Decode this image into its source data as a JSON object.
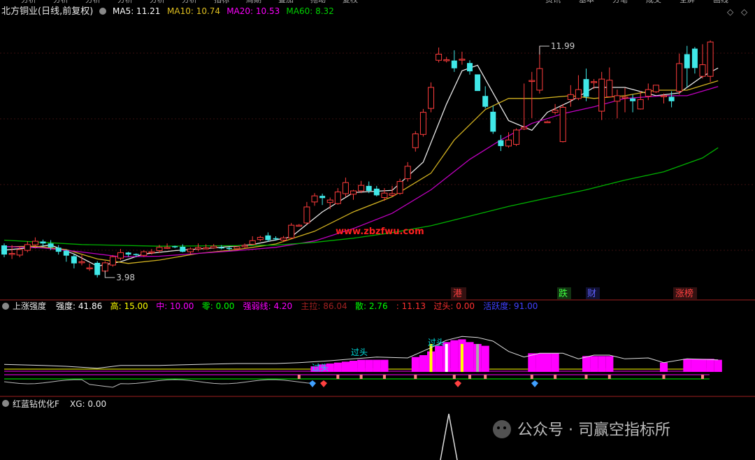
{
  "top_menu": [
    "分析",
    "分析",
    "分析",
    "分析",
    "分析",
    "分析",
    "指标",
    "周期",
    "叠加",
    "拖动",
    "复权"
  ],
  "top_right_menu": [
    "资讯",
    "基本",
    "分笔",
    "成交",
    "全屏",
    "画线"
  ],
  "main_panel": {
    "title": "北方铜业(日线,前复权)",
    "ma_labels": [
      {
        "text": "MA5: 11.21",
        "color": "#ffffff"
      },
      {
        "text": "MA10: 10.74",
        "color": "#e0c020"
      },
      {
        "text": "MA20: 10.53",
        "color": "#ff00ff"
      },
      {
        "text": "MA60: 8.32",
        "color": "#00d000"
      }
    ],
    "high_label": "11.99",
    "low_label": "3.98",
    "watermark": "www.zbzfwu.com",
    "event_tags": [
      {
        "text": "港",
        "color": "#ff4040"
      },
      {
        "text": "跌",
        "color": "#40ff40"
      },
      {
        "text": "财",
        "color": "#6060ff"
      },
      {
        "text": "涨榜",
        "color": "#ff4040"
      }
    ]
  },
  "indicator_panel": {
    "name": "上涨强度",
    "values": [
      {
        "text": "强度: 41.86",
        "color": "#ffffff"
      },
      {
        "text": "高: 15.00",
        "color": "#ffff00"
      },
      {
        "text": "中: 10.00",
        "color": "#ff00ff"
      },
      {
        "text": "零: 0.00",
        "color": "#00ff00"
      },
      {
        "text": "强弱线: 4.20",
        "color": "#ff00ff"
      },
      {
        "text": "主拉: 86.04",
        "color": "#a02020"
      },
      {
        "text": "散: 2.76",
        "color": "#00ff00"
      },
      {
        "text": ": 11.13",
        "color": "#ff3030"
      },
      {
        "text": "过头: 0.00",
        "color": "#ff3030"
      },
      {
        "text": "活跃度: 91.00",
        "color": "#4040ff"
      }
    ],
    "guotou_label": "过头"
  },
  "bottom_panel": {
    "name": "红蓝钻优化F",
    "value": "XG: 0.00"
  },
  "wechat": {
    "text": "公众号 · 司赢空指标所"
  },
  "chart_data": {
    "type": "candlestick",
    "title": "北方铜业(日线,前复权)",
    "ylim": [
      3.3,
      12.9
    ],
    "candles": [
      [
        4.79,
        4.46,
        4.86,
        4.36
      ],
      [
        4.5,
        4.5,
        4.8,
        4.3
      ],
      [
        4.44,
        4.64,
        4.76,
        4.36
      ],
      [
        4.61,
        4.82,
        4.94,
        4.54
      ],
      [
        4.81,
        4.94,
        5.08,
        4.68
      ],
      [
        4.93,
        4.86,
        5.0,
        4.74
      ],
      [
        4.86,
        4.72,
        4.98,
        4.62
      ],
      [
        4.71,
        4.56,
        4.8,
        4.46
      ],
      [
        4.6,
        4.42,
        4.64,
        4.2
      ],
      [
        4.4,
        4.14,
        4.46,
        3.96
      ],
      [
        4.2,
        4.2,
        4.44,
        4.07
      ],
      [
        3.98,
        3.98,
        4.14,
        3.87
      ],
      [
        4.16,
        3.72,
        4.22,
        3.63
      ],
      [
        3.86,
        4.16,
        4.22,
        3.8
      ],
      [
        4.08,
        4.38,
        4.44,
        4.02
      ],
      [
        4.33,
        4.53,
        4.66,
        4.26
      ],
      [
        4.53,
        4.46,
        4.56,
        4.38
      ],
      [
        4.48,
        4.46,
        4.5,
        4.36
      ],
      [
        4.43,
        4.56,
        4.61,
        4.37
      ],
      [
        4.56,
        4.56,
        4.66,
        4.46
      ],
      [
        4.6,
        4.72,
        4.81,
        4.52
      ],
      [
        4.72,
        4.72,
        4.86,
        4.66
      ],
      [
        4.76,
        4.75,
        4.78,
        4.69
      ],
      [
        4.74,
        4.56,
        4.83,
        4.54
      ],
      [
        4.56,
        4.66,
        4.72,
        4.48
      ],
      [
        4.66,
        4.71,
        4.86,
        4.58
      ],
      [
        4.7,
        4.7,
        4.83,
        4.66
      ],
      [
        4.7,
        4.76,
        4.84,
        4.67
      ],
      [
        4.72,
        4.71,
        4.8,
        4.65
      ],
      [
        4.7,
        4.66,
        4.74,
        4.6
      ],
      [
        4.67,
        4.74,
        4.76,
        4.61
      ],
      [
        4.74,
        4.79,
        4.86,
        4.7
      ],
      [
        4.83,
        4.96,
        5.12,
        4.8
      ],
      [
        5.0,
        5.08,
        5.14,
        4.94
      ],
      [
        5.15,
        4.98,
        5.26,
        4.92
      ],
      [
        5.05,
        5.02,
        5.12,
        4.96
      ],
      [
        4.98,
        5.06,
        5.13,
        4.91
      ],
      [
        5.06,
        5.52,
        5.6,
        5.03
      ],
      [
        5.52,
        5.52,
        5.56,
        5.48
      ],
      [
        5.6,
        6.18,
        6.36,
        5.55
      ],
      [
        6.36,
        6.58,
        6.68,
        6.22
      ],
      [
        6.58,
        6.5,
        6.66,
        6.25
      ],
      [
        6.34,
        6.43,
        6.52,
        6.1
      ],
      [
        6.3,
        6.72,
        6.86,
        6.26
      ],
      [
        6.66,
        7.06,
        7.24,
        6.54
      ],
      [
        6.64,
        6.76,
        6.8,
        6.44
      ],
      [
        6.76,
        6.96,
        7.12,
        6.68
      ],
      [
        6.94,
        6.76,
        7.1,
        6.68
      ],
      [
        6.84,
        6.6,
        6.94,
        6.56
      ],
      [
        6.52,
        6.68,
        6.86,
        6.4
      ],
      [
        6.6,
        6.66,
        6.94,
        6.56
      ],
      [
        6.67,
        7.1,
        7.2,
        6.62
      ],
      [
        7.2,
        7.65,
        7.8,
        7.1
      ],
      [
        8.32,
        8.82,
        8.92,
        8.18
      ],
      [
        8.8,
        9.6,
        9.72,
        8.72
      ],
      [
        9.74,
        10.5,
        10.68,
        9.6
      ],
      [
        11.48,
        11.7,
        11.94,
        11.4
      ],
      [
        11.5,
        11.5,
        11.6,
        11.4
      ],
      [
        11.47,
        11.19,
        11.84,
        11.06
      ],
      [
        11.52,
        11.52,
        11.79,
        11.32
      ],
      [
        11.38,
        11.08,
        11.48,
        10.96
      ],
      [
        10.97,
        10.37,
        10.82,
        10.54
      ],
      [
        10.19,
        9.8,
        10.54,
        9.74
      ],
      [
        9.62,
        8.9,
        9.84,
        8.82
      ],
      [
        8.59,
        8.38,
        8.78,
        8.2
      ],
      [
        8.38,
        8.6,
        8.88,
        8.32
      ],
      [
        8.44,
        8.96,
        9.02,
        8.38
      ],
      [
        9.0,
        9.06,
        10.64,
        8.96
      ],
      [
        10.75,
        10.75,
        11.06,
        9.39
      ],
      [
        10.4,
        11.18,
        11.99,
        10.28
      ],
      [
        9.26,
        9.26,
        9.3,
        9.22
      ],
      [
        9.6,
        9.68,
        9.9,
        9.52
      ],
      [
        8.54,
        9.78,
        9.9,
        8.51
      ],
      [
        10.06,
        10.24,
        10.58,
        9.8
      ],
      [
        10.1,
        10.42,
        10.94,
        10.04
      ],
      [
        10.8,
        10.16,
        11.18,
        10.0
      ],
      [
        10.71,
        10.71,
        10.8,
        10.44
      ],
      [
        9.64,
        10.8,
        11.06,
        9.32
      ],
      [
        10.16,
        10.76,
        11.22,
        10.16
      ],
      [
        10.0,
        10.2,
        10.42,
        9.38
      ],
      [
        10.12,
        10.15,
        10.48,
        9.6
      ],
      [
        10.1,
        10.0,
        10.24,
        9.6
      ],
      [
        9.72,
        10.06,
        10.36,
        9.7
      ],
      [
        10.18,
        10.42,
        10.64,
        10.04
      ],
      [
        10.34,
        10.58,
        10.58,
        10.3
      ],
      [
        10.2,
        10.2,
        10.28,
        9.92
      ],
      [
        10.16,
        10.0,
        10.36,
        9.78
      ],
      [
        10.36,
        11.36,
        11.72,
        10.24
      ],
      [
        11.7,
        11.19,
        12.0,
        10.5
      ],
      [
        11.9,
        11.2,
        11.96,
        11.0
      ],
      [
        10.9,
        11.32,
        12.06,
        10.82
      ],
      [
        10.9,
        12.14,
        12.2,
        10.7
      ]
    ],
    "ma_series": [
      {
        "name": "MA5",
        "color": "#e8e8e8",
        "points": [
          [
            0,
            4.62
          ],
          [
            3,
            4.7
          ],
          [
            6,
            4.8
          ],
          [
            9,
            4.48
          ],
          [
            12,
            4.04
          ],
          [
            15,
            4.2
          ],
          [
            18,
            4.48
          ],
          [
            22,
            4.6
          ],
          [
            27,
            4.7
          ],
          [
            32,
            4.82
          ],
          [
            37,
            5.1
          ],
          [
            41,
            6.0
          ],
          [
            45,
            6.7
          ],
          [
            50,
            6.78
          ],
          [
            54,
            7.8
          ],
          [
            57,
            9.9
          ],
          [
            59,
            11.1
          ],
          [
            61,
            11.3
          ],
          [
            63,
            10.3
          ],
          [
            65,
            9.3
          ],
          [
            68,
            8.95
          ],
          [
            70,
            9.6
          ],
          [
            73,
            10.0
          ],
          [
            76,
            10.5
          ],
          [
            80,
            10.5
          ],
          [
            84,
            10.2
          ],
          [
            87,
            10.3
          ],
          [
            90,
            10.9
          ],
          [
            92,
            11.2
          ]
        ]
      },
      {
        "name": "MA10",
        "color": "#d0b020",
        "points": [
          [
            0,
            4.74
          ],
          [
            4,
            4.76
          ],
          [
            8,
            4.64
          ],
          [
            12,
            4.3
          ],
          [
            16,
            4.14
          ],
          [
            20,
            4.26
          ],
          [
            25,
            4.5
          ],
          [
            30,
            4.64
          ],
          [
            35,
            4.84
          ],
          [
            40,
            5.3
          ],
          [
            45,
            6.0
          ],
          [
            50,
            6.55
          ],
          [
            55,
            7.4
          ],
          [
            58,
            8.6
          ],
          [
            62,
            9.7
          ],
          [
            65,
            10.1
          ],
          [
            69,
            10.1
          ],
          [
            73,
            10.2
          ],
          [
            76,
            10.1
          ],
          [
            80,
            10.2
          ],
          [
            84,
            10.4
          ],
          [
            88,
            10.4
          ],
          [
            92,
            10.74
          ]
        ]
      },
      {
        "name": "MA20",
        "color": "#c000c0",
        "points": [
          [
            0,
            4.75
          ],
          [
            5,
            4.7
          ],
          [
            10,
            4.55
          ],
          [
            15,
            4.38
          ],
          [
            20,
            4.4
          ],
          [
            25,
            4.5
          ],
          [
            30,
            4.6
          ],
          [
            35,
            4.72
          ],
          [
            40,
            4.95
          ],
          [
            45,
            5.4
          ],
          [
            50,
            5.95
          ],
          [
            55,
            6.8
          ],
          [
            60,
            7.9
          ],
          [
            64,
            8.6
          ],
          [
            68,
            9.2
          ],
          [
            72,
            9.55
          ],
          [
            76,
            9.8
          ],
          [
            80,
            10.1
          ],
          [
            85,
            10.2
          ],
          [
            88,
            10.2
          ],
          [
            92,
            10.53
          ]
        ]
      },
      {
        "name": "MA60",
        "color": "#00b000",
        "points": [
          [
            0,
            4.98
          ],
          [
            10,
            4.82
          ],
          [
            20,
            4.76
          ],
          [
            30,
            4.78
          ],
          [
            35,
            4.8
          ],
          [
            40,
            4.9
          ],
          [
            45,
            5.05
          ],
          [
            50,
            5.25
          ],
          [
            55,
            5.5
          ],
          [
            60,
            5.85
          ],
          [
            65,
            6.2
          ],
          [
            70,
            6.5
          ],
          [
            75,
            6.8
          ],
          [
            80,
            7.15
          ],
          [
            85,
            7.45
          ],
          [
            90,
            7.95
          ],
          [
            92,
            8.32
          ]
        ]
      }
    ],
    "indicator": {
      "ylim": [
        0,
        60
      ],
      "bars": [
        [
          40,
          6,
          "#ff00ff"
        ],
        [
          41,
          8,
          "#ff00ff"
        ],
        [
          42,
          9,
          "#ff00ff"
        ],
        [
          43,
          10,
          "#ff00ff"
        ],
        [
          44,
          11,
          "#ff00ff"
        ],
        [
          45,
          12,
          "#ff00ff"
        ],
        [
          46,
          13,
          "#ff00ff"
        ],
        [
          47,
          13,
          "#ff00ff"
        ],
        [
          48,
          13,
          "#ff00ff"
        ],
        [
          49,
          13,
          "#ff00ff"
        ],
        [
          53,
          16,
          "#ff00ff"
        ],
        [
          54,
          18,
          "#ff00ff"
        ],
        [
          55,
          22,
          "#ff00ff"
        ],
        [
          56,
          28,
          "#ff00ff"
        ],
        [
          57,
          32,
          "#ff00ff"
        ],
        [
          58,
          34,
          "#ff00ff"
        ],
        [
          59,
          35,
          "#ff00ff"
        ],
        [
          60,
          32,
          "#ff00ff"
        ],
        [
          61,
          30,
          "#ff00ff"
        ],
        [
          62,
          28,
          "#ff00ff"
        ],
        [
          68,
          20,
          "#ff00ff"
        ],
        [
          69,
          20,
          "#ff00ff"
        ],
        [
          70,
          20,
          "#ff00ff"
        ],
        [
          71,
          20,
          "#ff00ff"
        ],
        [
          75,
          17,
          "#ff00ff"
        ],
        [
          76,
          17,
          "#ff00ff"
        ],
        [
          77,
          17,
          "#ff00ff"
        ],
        [
          78,
          17,
          "#ff00ff"
        ],
        [
          85,
          10,
          "#ff00ff"
        ],
        [
          88,
          14,
          "#ff00ff"
        ],
        [
          89,
          14,
          "#ff00ff"
        ],
        [
          90,
          14,
          "#ff00ff"
        ],
        [
          91,
          14,
          "#ff00ff"
        ],
        [
          92,
          13,
          "#ff00ff"
        ]
      ],
      "line": [
        [
          0,
          8
        ],
        [
          5,
          7
        ],
        [
          8,
          6
        ],
        [
          12,
          4
        ],
        [
          15,
          7
        ],
        [
          20,
          7
        ],
        [
          25,
          8
        ],
        [
          30,
          9
        ],
        [
          35,
          9
        ],
        [
          38,
          10
        ],
        [
          42,
          12
        ],
        [
          45,
          14
        ],
        [
          48,
          16
        ],
        [
          52,
          15
        ],
        [
          55,
          26
        ],
        [
          57,
          34
        ],
        [
          59,
          38
        ],
        [
          61,
          37
        ],
        [
          63,
          33
        ],
        [
          65,
          22
        ],
        [
          67,
          16
        ],
        [
          69,
          20
        ],
        [
          72,
          20
        ],
        [
          74,
          14
        ],
        [
          76,
          18
        ],
        [
          78,
          18
        ],
        [
          80,
          14
        ],
        [
          83,
          15
        ],
        [
          85,
          10
        ],
        [
          88,
          14
        ],
        [
          92,
          13
        ]
      ]
    }
  }
}
